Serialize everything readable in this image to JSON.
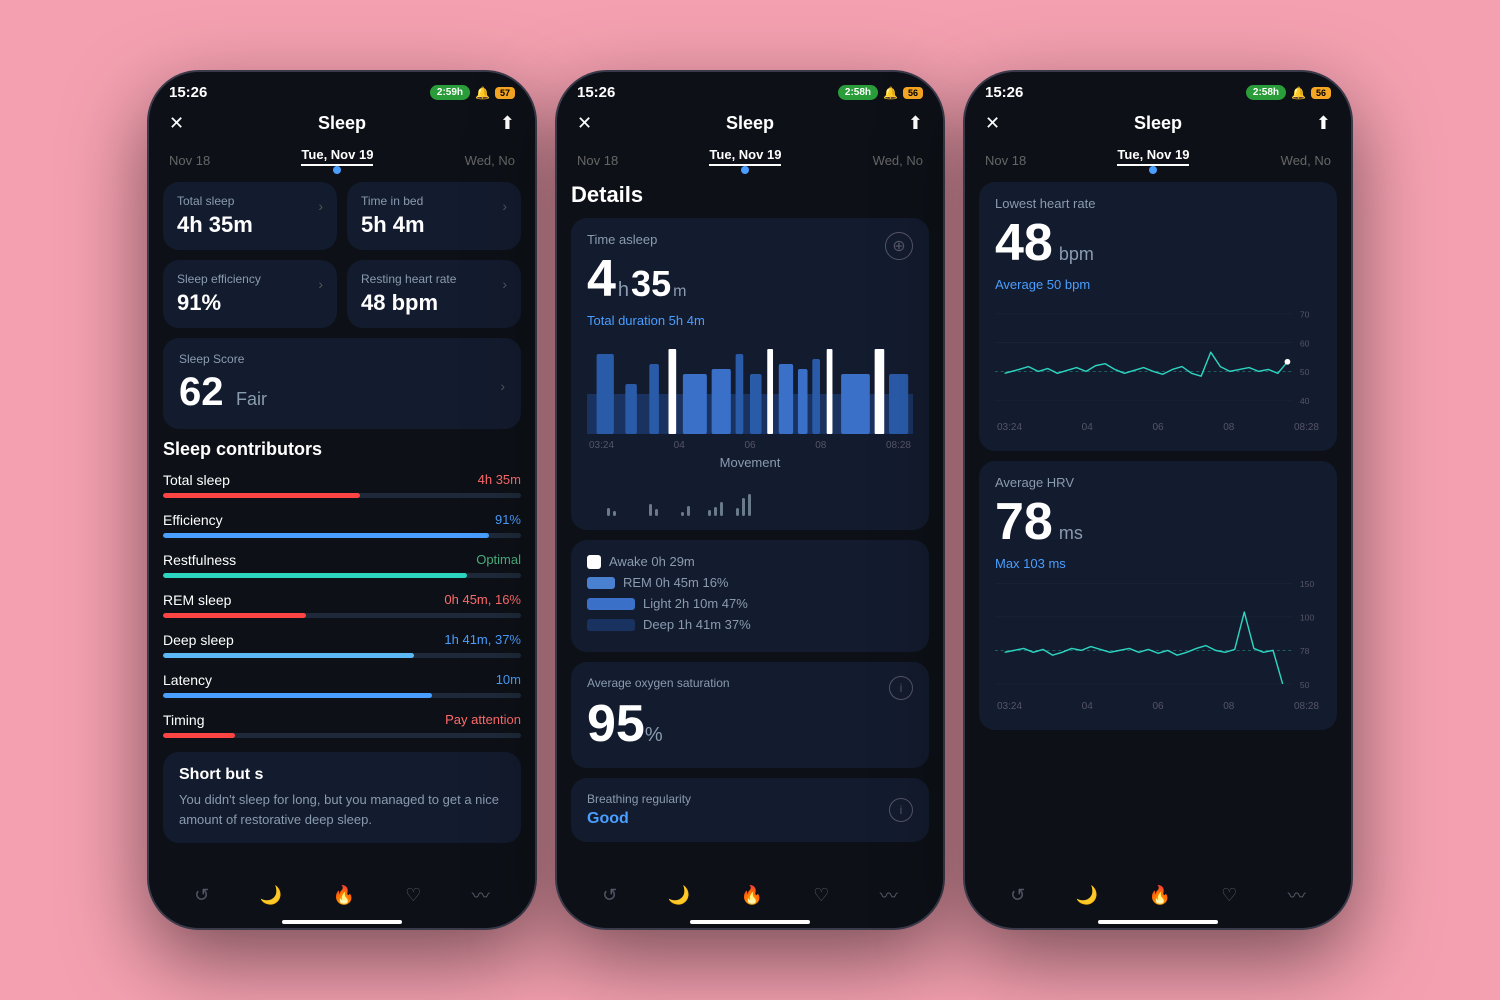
{
  "phones": [
    {
      "id": "phone1",
      "statusBar": {
        "time": "15:26",
        "timer": "2:59h",
        "battery": "57"
      },
      "header": {
        "title": "Sleep",
        "closeLabel": "✕",
        "shareLabel": "⬆"
      },
      "navTabs": {
        "prev": "Nov 18",
        "active": "Tue, Nov 19",
        "next": "Wed, No"
      },
      "summaryCards": [
        {
          "label": "Total sleep",
          "value": "4h 35m"
        },
        {
          "label": "Time in bed",
          "value": "5h 4m"
        },
        {
          "label": "Sleep efficiency",
          "value": "91%"
        },
        {
          "label": "Resting heart rate",
          "value": "48 bpm"
        }
      ],
      "sleepScore": {
        "label": "Sleep Score",
        "value": "62",
        "qualifier": "Fair"
      },
      "contributors": {
        "title": "Sleep contributors",
        "items": [
          {
            "name": "Total sleep",
            "value": "4h 35m",
            "color": "red",
            "pct": 55
          },
          {
            "name": "Efficiency",
            "value": "91%",
            "color": "blue",
            "pct": 91
          },
          {
            "name": "Restfulness",
            "value": "Optimal",
            "color": "green",
            "pct": 85
          },
          {
            "name": "REM sleep",
            "value": "0h 45m, 16%",
            "color": "red",
            "pct": 40
          },
          {
            "name": "Deep sleep",
            "value": "1h 41m, 37%",
            "color": "blue",
            "pct": 70
          },
          {
            "name": "Latency",
            "value": "10m",
            "color": "blue",
            "pct": 75
          },
          {
            "name": "Timing",
            "value": "Pay attention",
            "color": "red",
            "pct": 20
          }
        ]
      },
      "summary": {
        "title": "Short but s",
        "body": "You didn't sleep for long, but you managed to get a nice amount of restorative deep sleep."
      }
    },
    {
      "id": "phone2",
      "statusBar": {
        "time": "15:26",
        "timer": "2:58h",
        "battery": "56"
      },
      "header": {
        "title": "Sleep"
      },
      "navTabs": {
        "prev": "Nov 18",
        "active": "Tue, Nov 19",
        "next": "Wed, No"
      },
      "details": {
        "title": "Details",
        "timeAsleep": {
          "label": "Time asleep",
          "hours": "4",
          "minutes": "35",
          "totalDuration": "Total duration 5h 4m"
        },
        "chartTimeLabels": [
          "03:24",
          "04",
          "06",
          "08",
          "08:28"
        ],
        "movementLabel": "Movement",
        "legend": [
          {
            "label": "Awake 0h 29m",
            "color": "awake"
          },
          {
            "label": "REM 0h 45m 16%",
            "color": "rem"
          },
          {
            "label": "Light 2h 10m 47%",
            "color": "light"
          },
          {
            "label": "Deep 1h 41m 37%",
            "color": "deep"
          }
        ],
        "oxygenSaturation": {
          "label": "Average oxygen saturation",
          "value": "95",
          "unit": "%"
        },
        "breathing": {
          "label": "Breathing regularity",
          "value": "Good"
        }
      }
    },
    {
      "id": "phone3",
      "statusBar": {
        "time": "15:26",
        "timer": "2:58h",
        "battery": "56"
      },
      "header": {
        "title": "Sleep"
      },
      "navTabs": {
        "prev": "Nov 18",
        "active": "Tue, Nov 19",
        "next": "Wed, No"
      },
      "heartRate": {
        "label": "Lowest heart rate",
        "value": "48",
        "unit": "bpm",
        "avg": "Average 50 bpm",
        "chartTimeLabels": [
          "03:24",
          "04",
          "06",
          "08",
          "08:28"
        ],
        "chartYLabels": [
          "70",
          "60",
          "50",
          "40"
        ]
      },
      "hrv": {
        "label": "Average HRV",
        "value": "78",
        "unit": "ms",
        "max": "Max 103 ms",
        "chartYLabels": [
          "150",
          "100",
          "50"
        ]
      }
    }
  ]
}
